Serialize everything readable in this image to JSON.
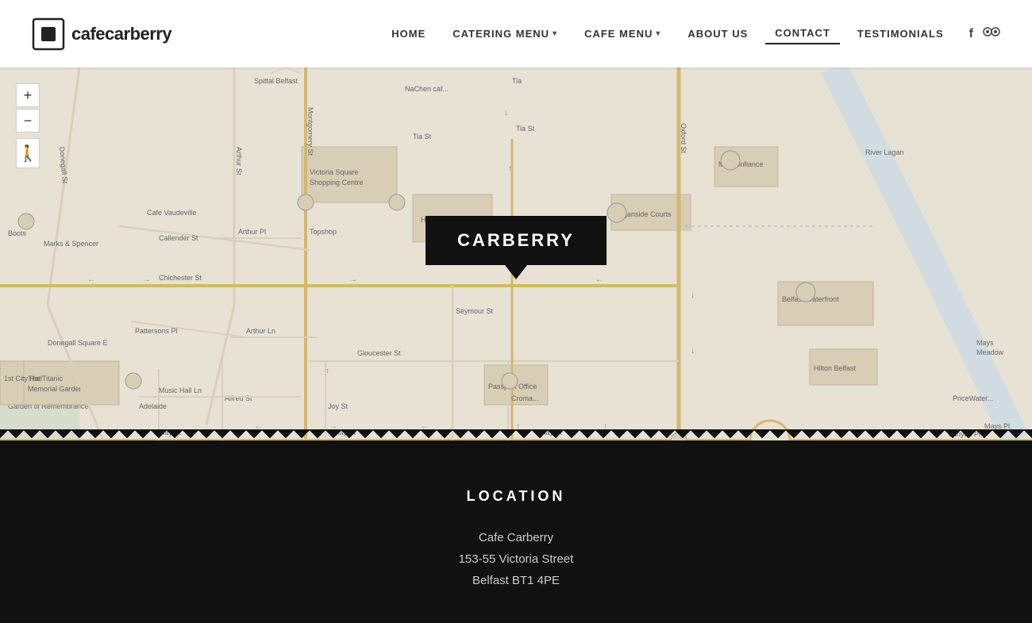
{
  "header": {
    "logo_text": "cafecarberry",
    "nav_items": [
      {
        "label": "HOME",
        "active": false,
        "has_arrow": false
      },
      {
        "label": "CATERING MENU",
        "active": false,
        "has_arrow": true
      },
      {
        "label": "CAFE MENU",
        "active": false,
        "has_arrow": true
      },
      {
        "label": "ABOUT US",
        "active": false,
        "has_arrow": false
      },
      {
        "label": "CONTACT",
        "active": true,
        "has_arrow": false
      },
      {
        "label": "TESTIMONIALS",
        "active": false,
        "has_arrow": false
      }
    ]
  },
  "map": {
    "marker_label": "CARBERRY",
    "zoom_in": "+",
    "zoom_out": "−"
  },
  "location": {
    "section_title": "LOCATION",
    "name": "Cafe Carberry",
    "address_line1": "153-55 Victoria Street",
    "address_line2": "Belfast BT1 4PE"
  }
}
